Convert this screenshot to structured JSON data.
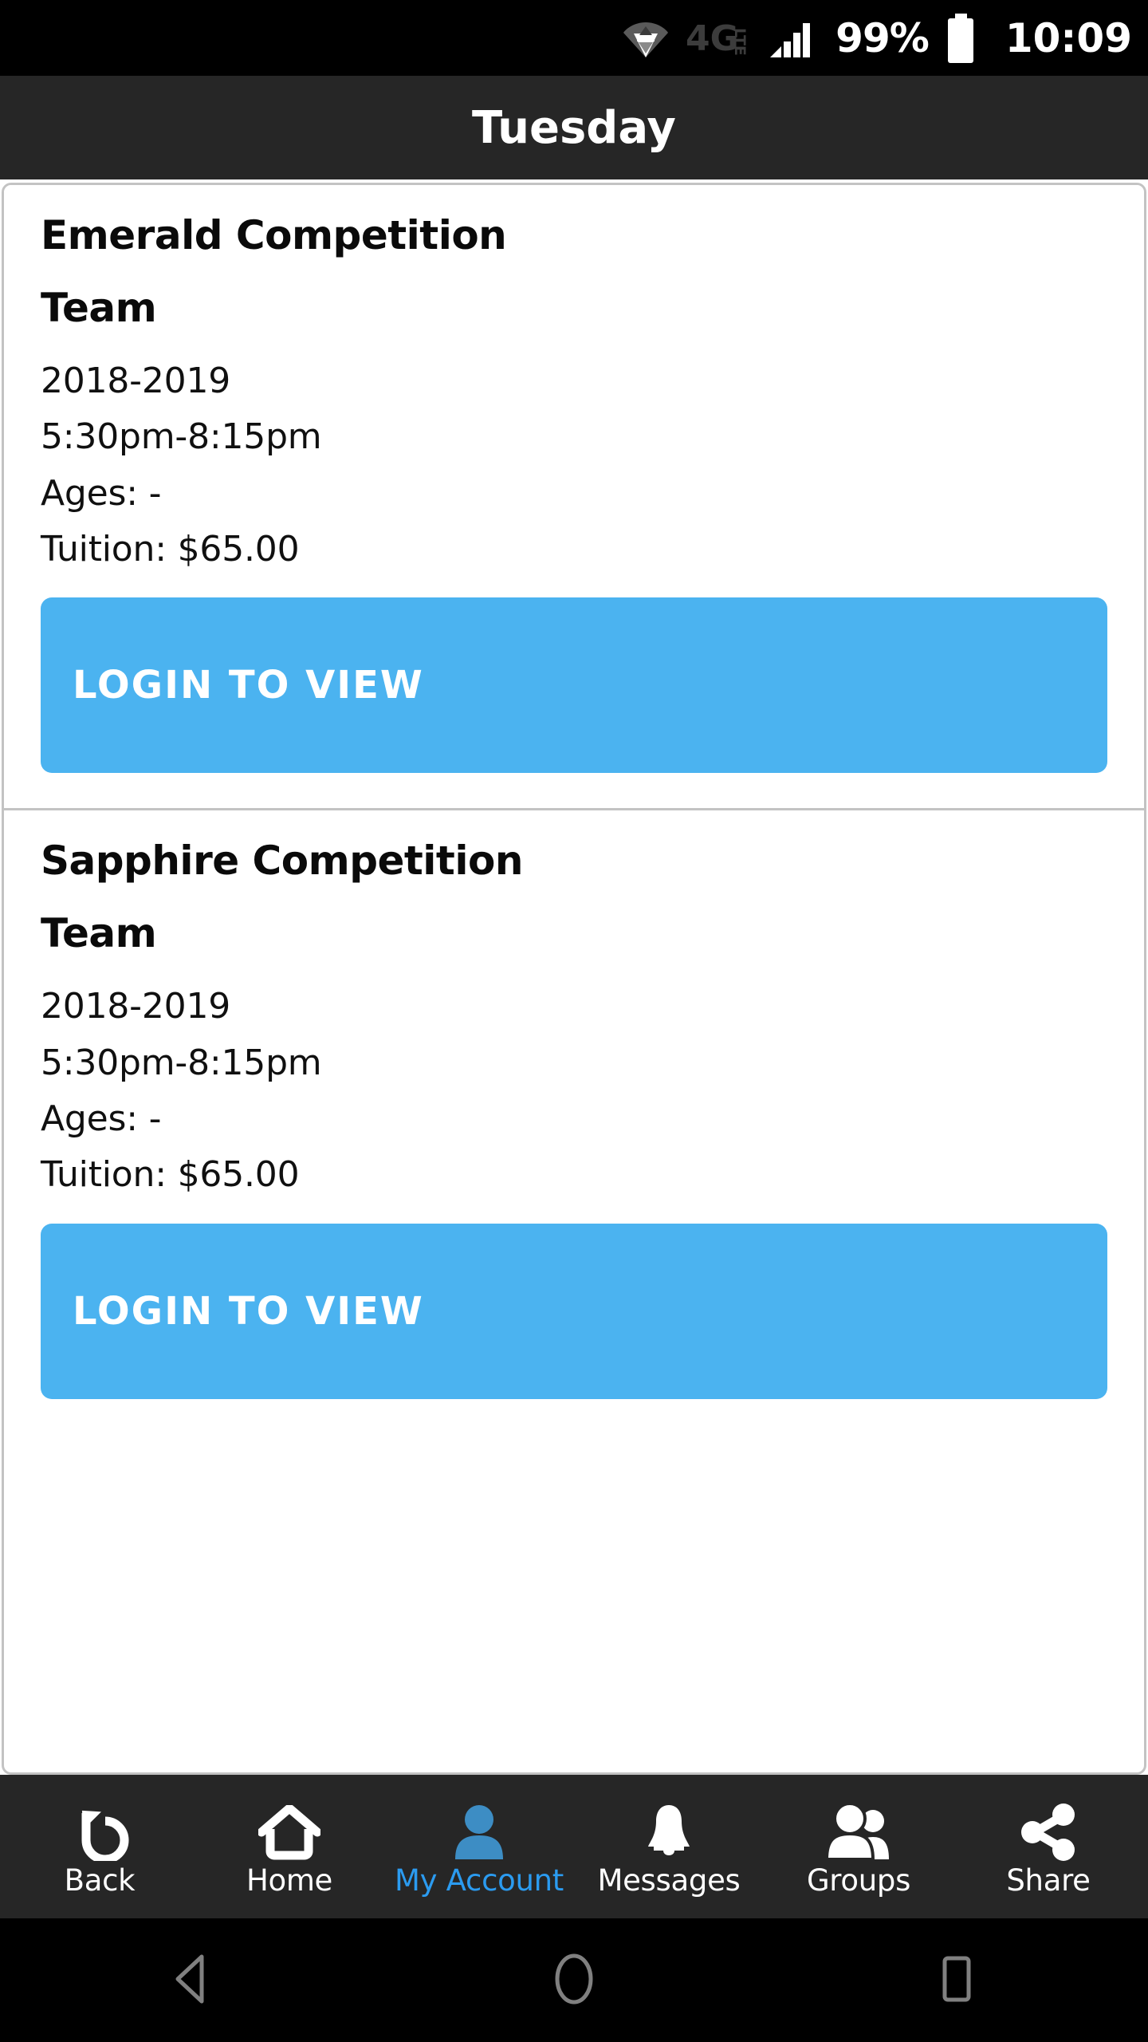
{
  "status_bar": {
    "wifi_icon": "wifi-icon",
    "network_label": "4G",
    "network_sub": "LTE",
    "signal_icon": "signal-bars-icon",
    "battery_percent": "99%",
    "battery_icon": "battery-full-icon",
    "time": "10:09"
  },
  "header": {
    "title": "Tuesday"
  },
  "cards": [
    {
      "title": "Emerald Competition",
      "subtitle": "Team",
      "season": "2018-2019",
      "time": "5:30pm-8:15pm",
      "ages": "Ages: -",
      "tuition": "Tuition: $65.00",
      "button_label": "LOGIN TO VIEW"
    },
    {
      "title": "Sapphire Competition",
      "subtitle": "Team",
      "season": "2018-2019",
      "time": "5:30pm-8:15pm",
      "ages": "Ages: -",
      "tuition": "Tuition: $65.00",
      "button_label": "LOGIN TO VIEW"
    }
  ],
  "bottom_nav": {
    "items": [
      {
        "label": "Back",
        "icon": "undo-arrow-icon",
        "active": false
      },
      {
        "label": "Home",
        "icon": "house-icon",
        "active": false
      },
      {
        "label": "My Account",
        "icon": "person-icon",
        "active": true
      },
      {
        "label": "Messages",
        "icon": "bell-icon",
        "active": false
      },
      {
        "label": "Groups",
        "icon": "people-icon",
        "active": false
      },
      {
        "label": "Share",
        "icon": "share-nodes-icon",
        "active": false
      }
    ]
  },
  "system_nav": {
    "back": "triangle-back-icon",
    "home": "circle-home-icon",
    "recents": "square-recents-icon"
  },
  "colors": {
    "accent_blue": "#4bb3f0",
    "active_nav_blue": "#2b9bf0",
    "nav_bar_bg": "#262626",
    "title_bar_bg": "#262626",
    "card_border": "#c3c3c3"
  }
}
